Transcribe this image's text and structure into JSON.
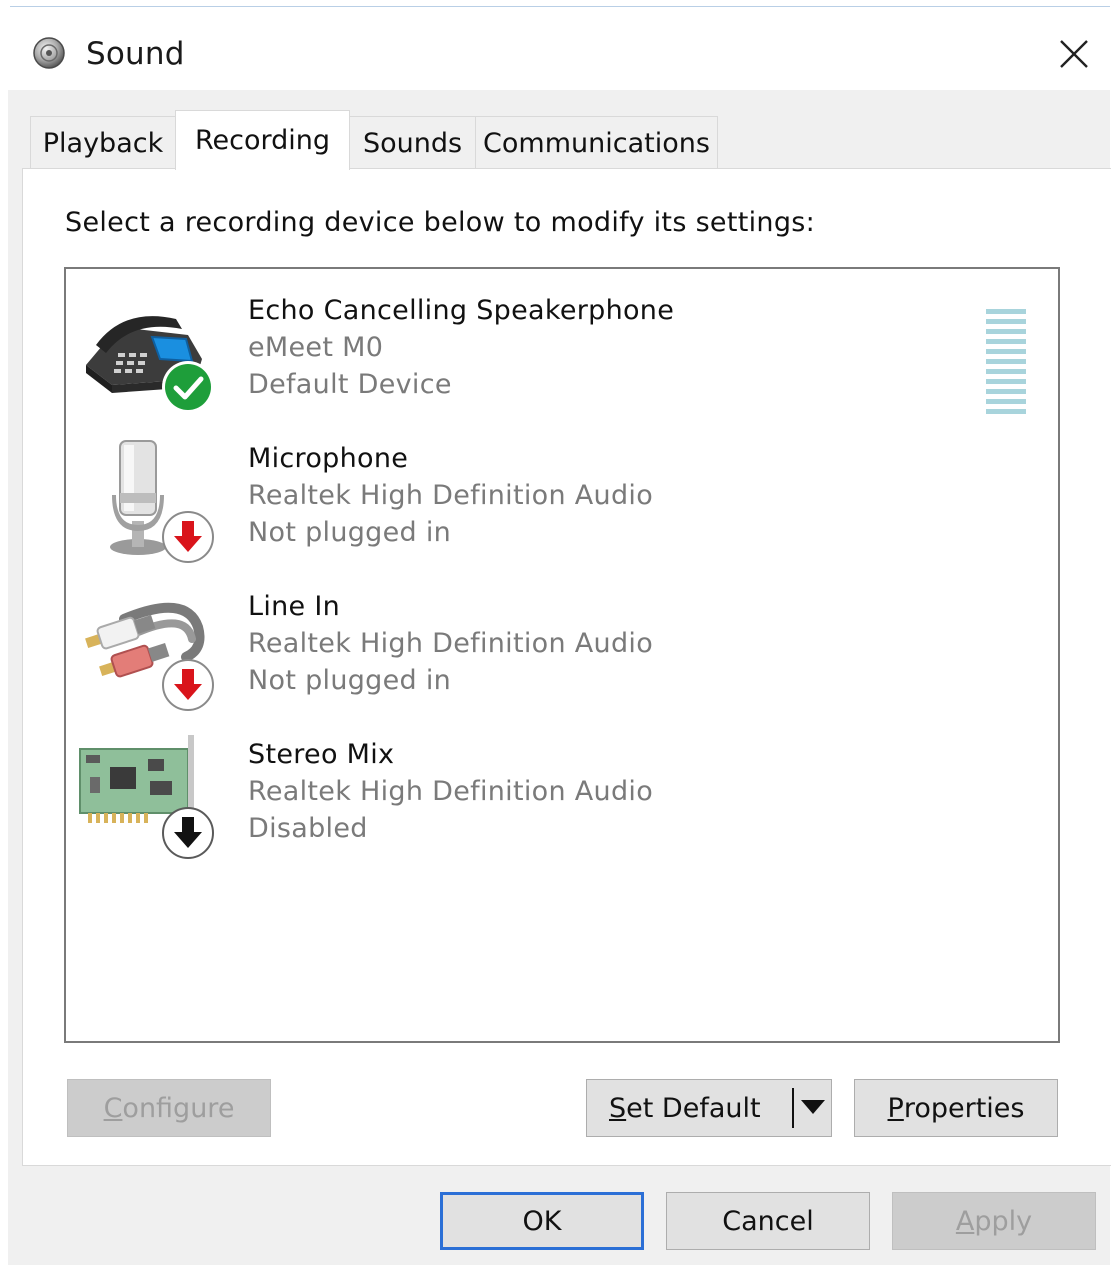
{
  "window": {
    "title": "Sound",
    "close_symbol": "✕"
  },
  "tabs": [
    {
      "label": "Playback",
      "active": false
    },
    {
      "label": "Recording",
      "active": true
    },
    {
      "label": "Sounds",
      "active": false
    },
    {
      "label": "Communications",
      "active": false
    }
  ],
  "panel": {
    "instruction": "Select a recording device below to modify its settings:"
  },
  "devices": [
    {
      "name": "Echo Cancelling Speakerphone",
      "description": "eMeet M0",
      "status": "Default Device",
      "icon": "speakerphone-icon",
      "badge": "check-badge-icon"
    },
    {
      "name": "Microphone",
      "description": "Realtek High Definition Audio",
      "status": "Not plugged in",
      "icon": "microphone-icon",
      "badge": "red-down-arrow-badge-icon"
    },
    {
      "name": "Line In",
      "description": "Realtek High Definition Audio",
      "status": "Not plugged in",
      "icon": "rca-cable-icon",
      "badge": "red-down-arrow-badge-icon"
    },
    {
      "name": "Stereo Mix",
      "description": "Realtek High Definition Audio",
      "status": "Disabled",
      "icon": "sound-card-icon",
      "badge": "black-down-arrow-badge-icon"
    }
  ],
  "buttons": {
    "configure": {
      "prefix": "",
      "accel": "C",
      "rest": "onfigure",
      "enabled": false
    },
    "set_default": {
      "prefix": "",
      "accel": "S",
      "rest": "et Default",
      "enabled": true
    },
    "properties": {
      "prefix": "",
      "accel": "P",
      "rest": "roperties",
      "enabled": true
    },
    "ok": "OK",
    "cancel": "Cancel",
    "apply": {
      "prefix": "",
      "accel": "A",
      "rest": "pply",
      "enabled": false
    }
  },
  "colors": {
    "accent_border": "#2b6fd6",
    "level_meter": "#a8d4dc",
    "check_green": "#1e9e3a",
    "arrow_red": "#d9141b"
  }
}
